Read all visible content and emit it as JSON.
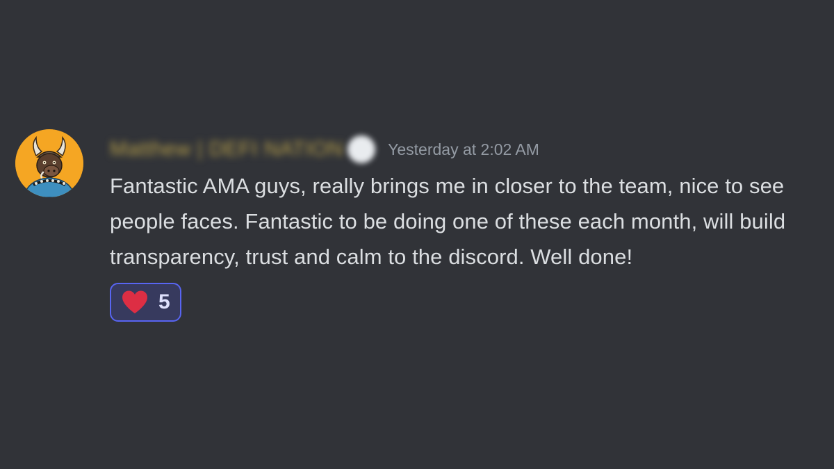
{
  "message": {
    "author": {
      "display_name": "Matthew | DEFI NATION",
      "avatar_icon": "viking-bull-avatar",
      "badge_icon": "heart-badge-icon",
      "name_color": "#b8a04a"
    },
    "timestamp": "Yesterday at 2:02 AM",
    "text": "Fantastic AMA guys, really brings me in closer to the team, nice to see people faces. Fantastic to be doing one of these each month, will build transparency, trust and calm to the discord. Well done!",
    "reactions": [
      {
        "emoji": "heart-icon",
        "count": "5",
        "active": true
      }
    ]
  },
  "colors": {
    "background": "#313338",
    "text": "#dbdee1",
    "timestamp": "#949ba4",
    "reaction_border": "#5865f2",
    "reaction_bg": "#373a5e",
    "heart": "#dd2e44"
  }
}
